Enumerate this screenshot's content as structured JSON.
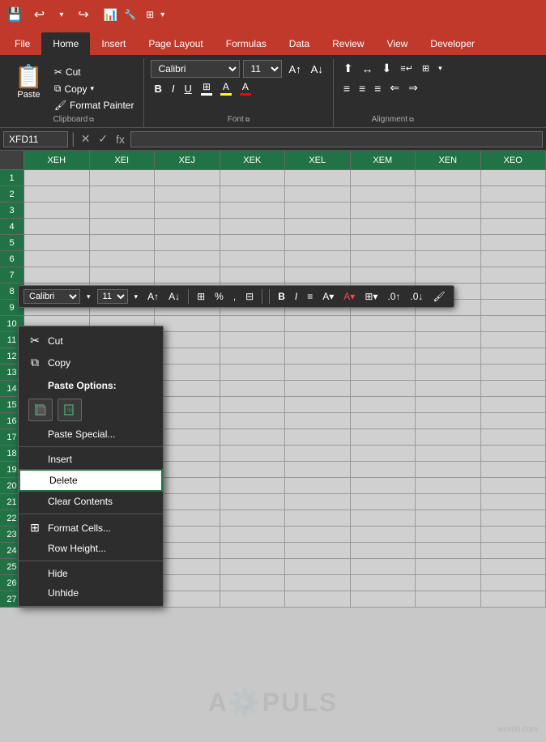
{
  "titlebar": {
    "save_icon": "💾",
    "undo_icon": "↩",
    "redo_icon": "↪"
  },
  "tabs": [
    {
      "label": "File",
      "active": false
    },
    {
      "label": "Home",
      "active": true
    },
    {
      "label": "Insert",
      "active": false
    },
    {
      "label": "Page Layout",
      "active": false
    },
    {
      "label": "Formulas",
      "active": false
    },
    {
      "label": "Data",
      "active": false
    },
    {
      "label": "Review",
      "active": false
    },
    {
      "label": "View",
      "active": false
    },
    {
      "label": "Developer",
      "active": false
    }
  ],
  "clipboard": {
    "paste_label": "Paste",
    "cut_label": "Cut",
    "copy_label": "Copy",
    "format_painter_label": "Format Painter",
    "group_label": "Clipboard"
  },
  "font": {
    "name": "Calibri",
    "size": "11",
    "group_label": "Font"
  },
  "alignment": {
    "group_label": "Alignment"
  },
  "formula_bar": {
    "cell_ref": "XFD11",
    "fx_label": "fx"
  },
  "columns": [
    "XEH",
    "XEI",
    "XEJ",
    "XEK",
    "XEL",
    "XEM",
    "XEN",
    "XEO"
  ],
  "rows": [
    1,
    2,
    3,
    4,
    5,
    6,
    7,
    8,
    9,
    10,
    11,
    12,
    13,
    14,
    15,
    16,
    17,
    18,
    19,
    20,
    21,
    22,
    23,
    24,
    25,
    26,
    27
  ],
  "mini_toolbar": {
    "font": "Calibri",
    "size": "11"
  },
  "context_menu": {
    "cut_label": "Cut",
    "copy_label": "Copy",
    "paste_options_label": "Paste Options:",
    "paste_special_label": "Paste Special...",
    "insert_label": "Insert",
    "delete_label": "Delete",
    "clear_contents_label": "Clear Contents",
    "format_cells_label": "Format Cells...",
    "row_height_label": "Row Height...",
    "hide_label": "Hide",
    "unhide_label": "Unhide"
  },
  "watermark": {
    "text": "A⚙️PULS",
    "site": "wsxdn.com"
  }
}
